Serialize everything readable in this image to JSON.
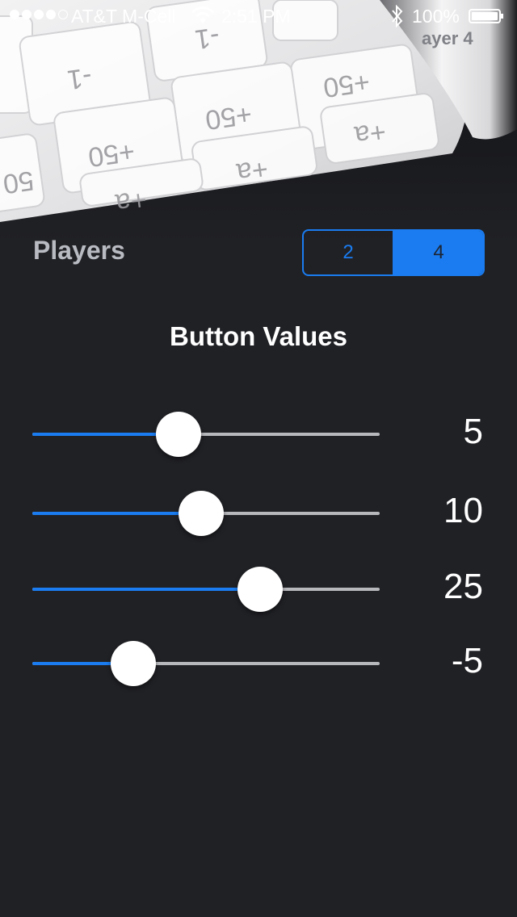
{
  "status_bar": {
    "carrier": "AT&T M-Cell",
    "time": "2:51 PM",
    "battery": "100%",
    "signal_bars_filled": 4,
    "signal_bars_total": 5
  },
  "background_page": {
    "player_label": "ayer 4",
    "buttons": [
      "-1",
      "-1",
      "+50",
      "+50",
      "+50",
      "50",
      "+a",
      "+a",
      "+a"
    ]
  },
  "players": {
    "label": "Players",
    "options": [
      "2",
      "4"
    ],
    "selected": "4"
  },
  "section_title": "Button Values",
  "sliders": [
    {
      "value_label": "5",
      "fraction": 0.42
    },
    {
      "value_label": "10",
      "fraction": 0.485
    },
    {
      "value_label": "25",
      "fraction": 0.655
    },
    {
      "value_label": "-5",
      "fraction": 0.29
    }
  ],
  "colors": {
    "accent": "#1a7cf0",
    "background": "#202125",
    "track": "#b7b8bc",
    "text": "#ffffff"
  }
}
